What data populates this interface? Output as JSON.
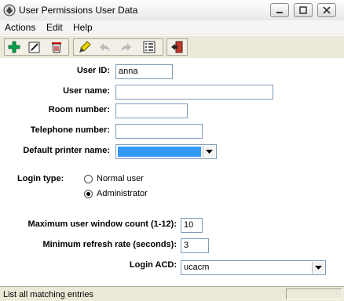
{
  "window": {
    "title": "User Permissions User Data"
  },
  "menu": [
    "Actions",
    "Edit",
    "Help"
  ],
  "toolbar": {
    "buttons": [
      "add-icon",
      "edit-icon",
      "delete-icon",
      "clear-icon",
      "undo-icon",
      "redo-icon",
      "list-icon",
      "exit-icon"
    ]
  },
  "form": {
    "user_id": {
      "label": "User ID:",
      "value": "anna"
    },
    "user_name": {
      "label": "User name:",
      "value": ""
    },
    "room_number": {
      "label": "Room number:",
      "value": ""
    },
    "telephone_number": {
      "label": "Telephone number:",
      "value": ""
    },
    "default_printer": {
      "label": "Default printer name:",
      "value": ""
    },
    "login_type": {
      "label": "Login type:",
      "options": [
        "Normal user",
        "Administrator"
      ],
      "selected": "Administrator"
    },
    "max_window_count": {
      "label": "Maximum user window count (1-12):",
      "value": "10"
    },
    "min_refresh_rate": {
      "label": "Minimum refresh rate (seconds):",
      "value": "3"
    },
    "login_acd": {
      "label": "Login ACD:",
      "value": "ucacm"
    }
  },
  "status": {
    "text": "List all matching entries"
  },
  "colors": {
    "selection": "#3399ff",
    "field_border": "#7f9db9"
  }
}
